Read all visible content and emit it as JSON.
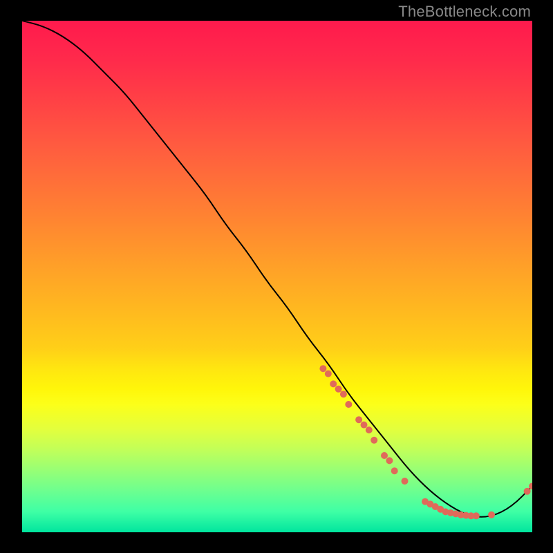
{
  "watermark_text": "TheBottleneck.com",
  "chart_data": {
    "type": "line",
    "title": "",
    "xlabel": "",
    "ylabel": "",
    "xlim": [
      0,
      100
    ],
    "ylim": [
      0,
      100
    ],
    "grid": false,
    "legend": false,
    "series": [
      {
        "name": "bottleneck-curve",
        "color": "#000000",
        "x": [
          0,
          4,
          8,
          12,
          16,
          20,
          24,
          28,
          32,
          36,
          40,
          44,
          48,
          52,
          56,
          60,
          64,
          68,
          72,
          76,
          80,
          84,
          88,
          92,
          96,
          100
        ],
        "y": [
          100,
          99,
          97,
          94,
          90,
          86,
          81,
          76,
          71,
          66,
          60,
          55,
          49,
          44,
          38,
          33,
          27,
          22,
          17,
          12,
          8,
          5,
          3,
          3,
          5,
          9
        ]
      }
    ],
    "scatter_points": {
      "name": "gpu-models",
      "color": "#e06a5a",
      "radius_px": 5,
      "points": [
        {
          "x": 59,
          "y": 32
        },
        {
          "x": 60,
          "y": 31
        },
        {
          "x": 61,
          "y": 29
        },
        {
          "x": 62,
          "y": 28
        },
        {
          "x": 63,
          "y": 27
        },
        {
          "x": 64,
          "y": 25
        },
        {
          "x": 66,
          "y": 22
        },
        {
          "x": 67,
          "y": 21
        },
        {
          "x": 68,
          "y": 20
        },
        {
          "x": 69,
          "y": 18
        },
        {
          "x": 71,
          "y": 15
        },
        {
          "x": 72,
          "y": 14
        },
        {
          "x": 73,
          "y": 12
        },
        {
          "x": 75,
          "y": 10
        },
        {
          "x": 79,
          "y": 6
        },
        {
          "x": 80,
          "y": 5.5
        },
        {
          "x": 81,
          "y": 5
        },
        {
          "x": 82,
          "y": 4.5
        },
        {
          "x": 83,
          "y": 4
        },
        {
          "x": 84,
          "y": 3.8
        },
        {
          "x": 85,
          "y": 3.6
        },
        {
          "x": 86,
          "y": 3.4
        },
        {
          "x": 87,
          "y": 3.3
        },
        {
          "x": 88,
          "y": 3.2
        },
        {
          "x": 89,
          "y": 3.2
        },
        {
          "x": 92,
          "y": 3.4
        },
        {
          "x": 99,
          "y": 8
        },
        {
          "x": 100,
          "y": 9
        }
      ]
    }
  }
}
